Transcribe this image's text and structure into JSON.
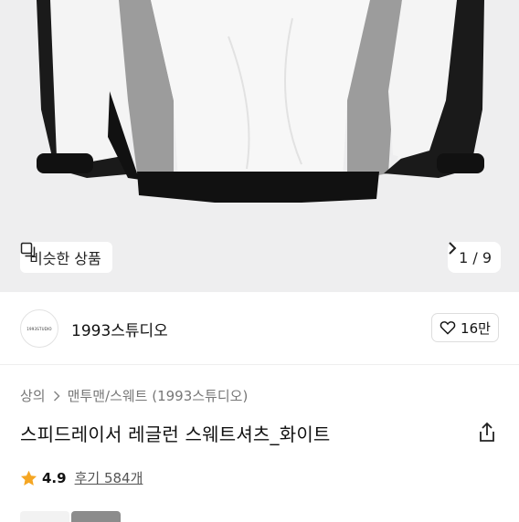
{
  "image_viewer": {
    "similar_label": "비슷한 상품",
    "page_indicator": "1 / 9"
  },
  "brand": {
    "logo_text": "1993STUDIO",
    "name": "1993스튜디오",
    "like_count": "16만"
  },
  "breadcrumb": {
    "items": [
      "상의",
      "맨투맨/스웨트 (1993스튜디오)"
    ]
  },
  "product": {
    "title": "스피드레이서 레글런 스웨트셔츠_화이트"
  },
  "rating": {
    "score": "4.9",
    "reviews": "후기 584개"
  },
  "colors": {
    "star": "#f5a623",
    "image_bg": "#eeeeef"
  }
}
